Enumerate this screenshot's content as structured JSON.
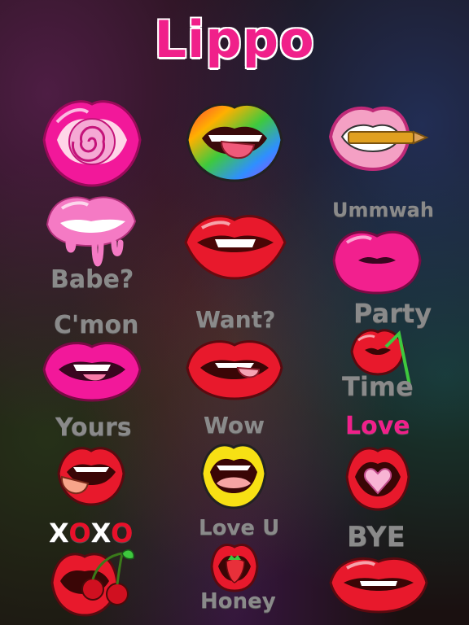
{
  "app": {
    "title": "Lippo"
  },
  "colors": {
    "brand_pink": "#f0208a",
    "lip_red": "#e8192c",
    "caption_grey": "#8a8a8a"
  },
  "stickers": [
    {
      "id": "lollipop",
      "caption": ""
    },
    {
      "id": "rainbow-tongue",
      "caption": ""
    },
    {
      "id": "bullet-bite",
      "caption": ""
    },
    {
      "id": "dripping-pink",
      "caption": "Babe?"
    },
    {
      "id": "lip-bite",
      "caption": ""
    },
    {
      "id": "kiss-pink",
      "caption": "Ummwah"
    },
    {
      "id": "pink-tongue",
      "caption": "C'mon"
    },
    {
      "id": "red-tongue",
      "caption": "Want?"
    },
    {
      "id": "cherry-straw",
      "caption_top": "Party",
      "caption_bottom": "Time"
    },
    {
      "id": "tongue-out",
      "caption": "Yours"
    },
    {
      "id": "yellow-open",
      "caption": "Wow"
    },
    {
      "id": "heart-candy",
      "caption": "Love"
    },
    {
      "id": "cherries",
      "caption": "XOXO"
    },
    {
      "id": "strawberry",
      "caption_top": "Love U",
      "caption_bottom": "Honey"
    },
    {
      "id": "red-smile",
      "caption": "BYE"
    }
  ]
}
